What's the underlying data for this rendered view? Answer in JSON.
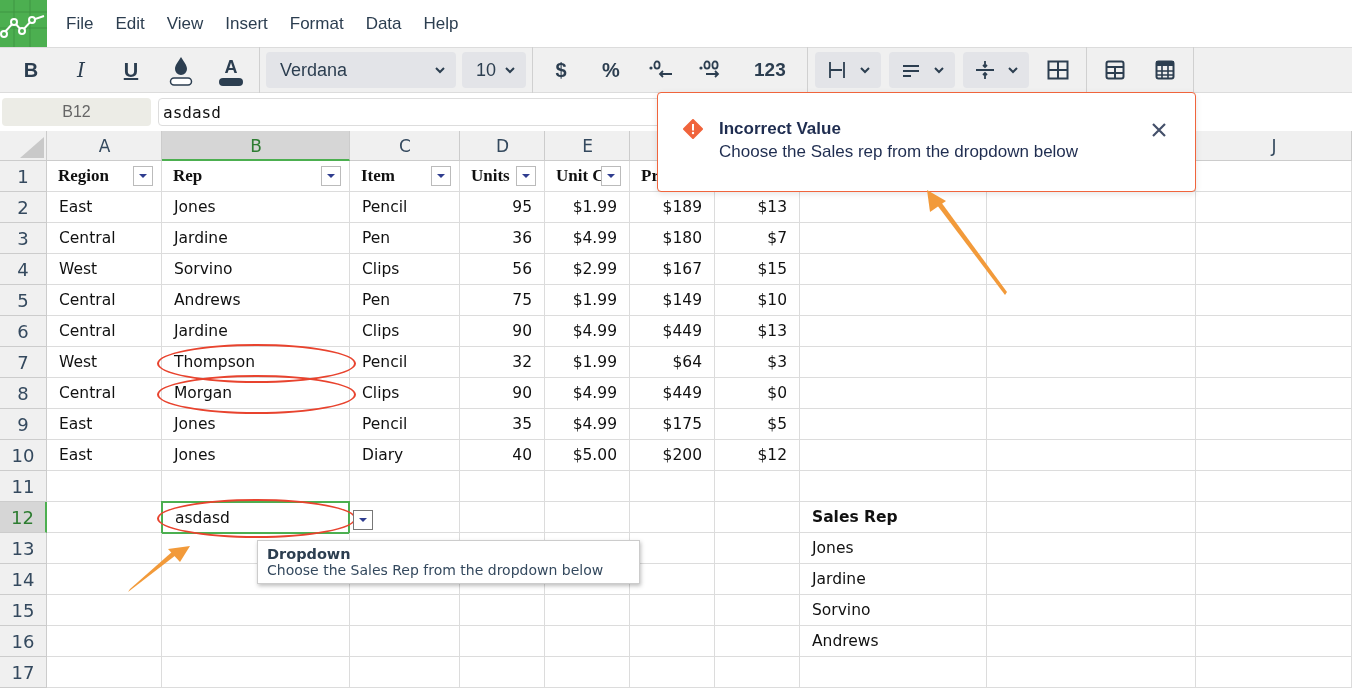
{
  "menu": [
    "File",
    "Edit",
    "View",
    "Insert",
    "Format",
    "Data",
    "Help"
  ],
  "toolbar": {
    "bold": "B",
    "italic": "I",
    "underline": "U",
    "text_color": "A",
    "font": "Verdana",
    "size": "10",
    "currency": "$",
    "percent": "%",
    "number_format": "123"
  },
  "formula_bar": {
    "cell_ref": "B12",
    "value": "asdasd"
  },
  "columns": [
    {
      "label": "A",
      "selected": false
    },
    {
      "label": "B",
      "selected": true
    },
    {
      "label": "C",
      "selected": false
    },
    {
      "label": "D",
      "selected": false
    },
    {
      "label": "E",
      "selected": false
    },
    {
      "label": "J",
      "selected": false
    }
  ],
  "rows": [
    {
      "number": "1",
      "selected": false,
      "cells": [
        {
          "text": "Region",
          "kind": "filter_header"
        },
        {
          "text": "Rep",
          "kind": "filter_header"
        },
        {
          "text": "Item",
          "kind": "filter_header"
        },
        {
          "text": "Units",
          "kind": "filter_header"
        },
        {
          "text": "Unit C",
          "kind": "filter_header"
        },
        {
          "text": "Pr",
          "kind": "header"
        }
      ]
    },
    {
      "number": "2",
      "selected": false,
      "cells": [
        {
          "text": "East",
          "kind": "text"
        },
        {
          "text": "Jones",
          "kind": "text"
        },
        {
          "text": "Pencil",
          "kind": "text"
        },
        {
          "text": "95",
          "kind": "number"
        },
        {
          "text": "$1.99",
          "kind": "number"
        },
        {
          "text": "$189",
          "kind": "number"
        },
        {
          "text": "$13",
          "kind": "number"
        }
      ]
    },
    {
      "number": "3",
      "selected": false,
      "cells": [
        {
          "text": "Central",
          "kind": "text"
        },
        {
          "text": "Jardine",
          "kind": "text"
        },
        {
          "text": "Pen",
          "kind": "text"
        },
        {
          "text": "36",
          "kind": "number"
        },
        {
          "text": "$4.99",
          "kind": "number"
        },
        {
          "text": "$180",
          "kind": "number"
        },
        {
          "text": "$7",
          "kind": "number"
        }
      ]
    },
    {
      "number": "4",
      "selected": false,
      "cells": [
        {
          "text": "West",
          "kind": "text"
        },
        {
          "text": "Sorvino",
          "kind": "text"
        },
        {
          "text": "Clips",
          "kind": "text"
        },
        {
          "text": "56",
          "kind": "number"
        },
        {
          "text": "$2.99",
          "kind": "number"
        },
        {
          "text": "$167",
          "kind": "number"
        },
        {
          "text": "$15",
          "kind": "number"
        }
      ]
    },
    {
      "number": "5",
      "selected": false,
      "cells": [
        {
          "text": "Central",
          "kind": "text"
        },
        {
          "text": "Andrews",
          "kind": "text"
        },
        {
          "text": "Pen",
          "kind": "text"
        },
        {
          "text": "75",
          "kind": "number"
        },
        {
          "text": "$1.99",
          "kind": "number"
        },
        {
          "text": "$149",
          "kind": "number"
        },
        {
          "text": "$10",
          "kind": "number"
        }
      ]
    },
    {
      "number": "6",
      "selected": false,
      "cells": [
        {
          "text": "Central",
          "kind": "text"
        },
        {
          "text": "Jardine",
          "kind": "text"
        },
        {
          "text": "Clips",
          "kind": "text"
        },
        {
          "text": "90",
          "kind": "number"
        },
        {
          "text": "$4.99",
          "kind": "number"
        },
        {
          "text": "$449",
          "kind": "number"
        },
        {
          "text": "$13",
          "kind": "number"
        }
      ]
    },
    {
      "number": "7",
      "selected": false,
      "cells": [
        {
          "text": "West",
          "kind": "text"
        },
        {
          "text": "Thompson",
          "kind": "text",
          "circled": true
        },
        {
          "text": "Pencil",
          "kind": "text"
        },
        {
          "text": "32",
          "kind": "number"
        },
        {
          "text": "$1.99",
          "kind": "number"
        },
        {
          "text": "$64",
          "kind": "number"
        },
        {
          "text": "$3",
          "kind": "number"
        }
      ]
    },
    {
      "number": "8",
      "selected": false,
      "cells": [
        {
          "text": "Central",
          "kind": "text"
        },
        {
          "text": "Morgan",
          "kind": "text",
          "circled": true
        },
        {
          "text": "Clips",
          "kind": "text"
        },
        {
          "text": "90",
          "kind": "number"
        },
        {
          "text": "$4.99",
          "kind": "number"
        },
        {
          "text": "$449",
          "kind": "number"
        },
        {
          "text": "$0",
          "kind": "number"
        }
      ]
    },
    {
      "number": "9",
      "selected": false,
      "cells": [
        {
          "text": "East",
          "kind": "text"
        },
        {
          "text": "Jones",
          "kind": "text"
        },
        {
          "text": "Pencil",
          "kind": "text"
        },
        {
          "text": "35",
          "kind": "number"
        },
        {
          "text": "$4.99",
          "kind": "number"
        },
        {
          "text": "$175",
          "kind": "number"
        },
        {
          "text": "$5",
          "kind": "number"
        }
      ]
    },
    {
      "number": "10",
      "selected": false,
      "cells": [
        {
          "text": "East",
          "kind": "text"
        },
        {
          "text": "Jones",
          "kind": "text"
        },
        {
          "text": "Diary",
          "kind": "text"
        },
        {
          "text": "40",
          "kind": "number"
        },
        {
          "text": "$5.00",
          "kind": "number"
        },
        {
          "text": "$200",
          "kind": "number"
        },
        {
          "text": "$12",
          "kind": "number"
        }
      ]
    },
    {
      "number": "11",
      "selected": false
    },
    {
      "number": "12",
      "selected": true,
      "cells": [
        null,
        {
          "text": "asdasd",
          "kind": "text",
          "circled": true
        },
        null,
        null,
        null,
        null,
        null,
        {
          "text": "Sales Rep",
          "kind": "label"
        }
      ]
    },
    {
      "number": "13",
      "selected": false,
      "cells": [
        null,
        null,
        null,
        null,
        null,
        null,
        null,
        {
          "text": "Jones",
          "kind": "text"
        }
      ]
    },
    {
      "number": "14",
      "selected": false,
      "cells": [
        null,
        null,
        null,
        null,
        null,
        null,
        null,
        {
          "text": "Jardine",
          "kind": "text"
        }
      ]
    },
    {
      "number": "15",
      "selected": false,
      "cells": [
        null,
        null,
        null,
        null,
        null,
        null,
        null,
        {
          "text": "Sorvino",
          "kind": "text"
        }
      ]
    },
    {
      "number": "16",
      "selected": false,
      "cells": [
        null,
        null,
        null,
        null,
        null,
        null,
        null,
        {
          "text": "Andrews",
          "kind": "text"
        }
      ]
    },
    {
      "number": "17",
      "selected": false
    }
  ],
  "tooltip": {
    "title": "Dropdown",
    "message": "Choose the Sales Rep from the dropdown below"
  },
  "alert": {
    "title": "Incorrect Value",
    "message": "Choose the Sales rep from the dropdown below"
  }
}
